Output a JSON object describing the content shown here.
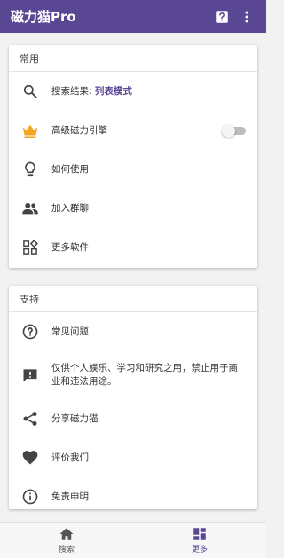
{
  "appbar": {
    "title": "磁力猫Pro"
  },
  "common": {
    "header": "常用",
    "search": {
      "prefix": "搜索结果: ",
      "mode": "列表模式"
    },
    "engine": {
      "label": "高级磁力引擎",
      "enabled": false
    },
    "howto": "如何使用",
    "group": "加入群聊",
    "more_software": "更多软件"
  },
  "support": {
    "header": "支持",
    "faq": "常见问题",
    "notice": "仅供个人娱乐、学习和研究之用，禁止用于商业和违法用途。",
    "share": "分享磁力猫",
    "rate": "评价我们",
    "disclaimer": "免责申明"
  },
  "bottom": {
    "tabs": [
      {
        "label": "搜索",
        "icon": "home-icon"
      },
      {
        "label": "更多",
        "icon": "dashboard-icon"
      }
    ],
    "active_tab": "更多"
  },
  "colors": {
    "primary": "#5a4794",
    "crown": "#f4a623",
    "icon": "#444444"
  }
}
